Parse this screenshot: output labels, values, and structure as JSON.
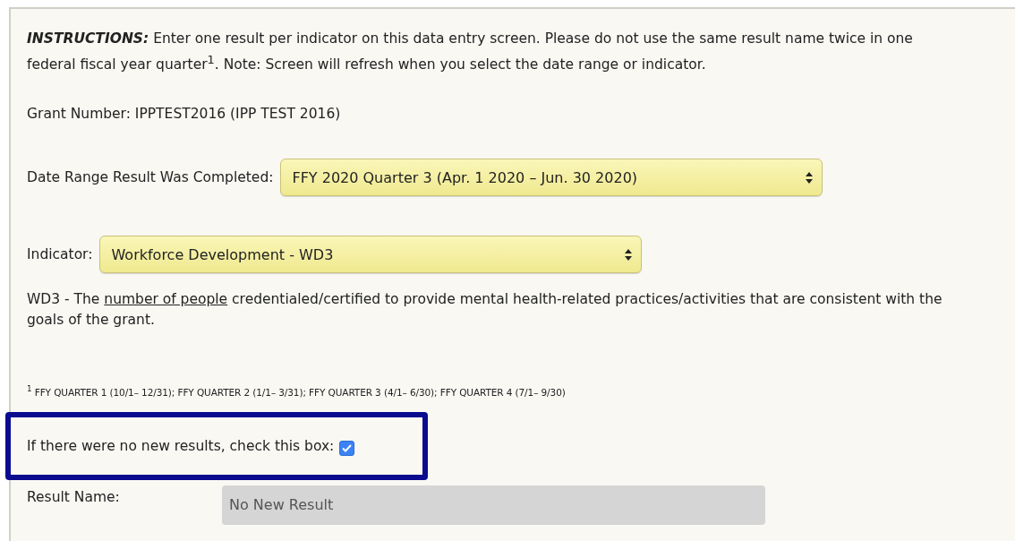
{
  "instructions": {
    "label": "INSTRUCTIONS:",
    "text": "Enter one result per indicator on this data entry screen. Please do not use the same result name twice in one federal fiscal year quarter$^{1}$. Note: Screen will refresh when you select the date range or indicator."
  },
  "grant_number": "Grant Number: IPPTEST2016 (IPP TEST 2016)",
  "date_range": {
    "label": "Date Range Result Was Completed:",
    "value": "FFY 2020 Quarter 3 (Apr. 1 2020 – Jun. 30 2020)"
  },
  "indicator": {
    "label": "Indicator:",
    "value": "Workforce Development - WD3"
  },
  "indicator_description": {
    "before": "WD3 - The ",
    "underlined": "number of people",
    "after": " credentialed/certified to provide mental health-related practices/activities that are consistent with the goals of the grant."
  },
  "footnote": "$^{1}$ FFY QUARTER 1 (10/1– 12/31); FFY QUARTER 2 (1/1– 3/31); FFY QUARTER 3 (4/1– 6/30); FFY QUARTER 4 (7/1– 9/30)",
  "no_new_results": {
    "label": "If there were no new results, check this box:",
    "checked": true,
    "highlighted": true
  },
  "result_name": {
    "label": "Result Name:",
    "value": "No New Result",
    "disabled": true
  }
}
